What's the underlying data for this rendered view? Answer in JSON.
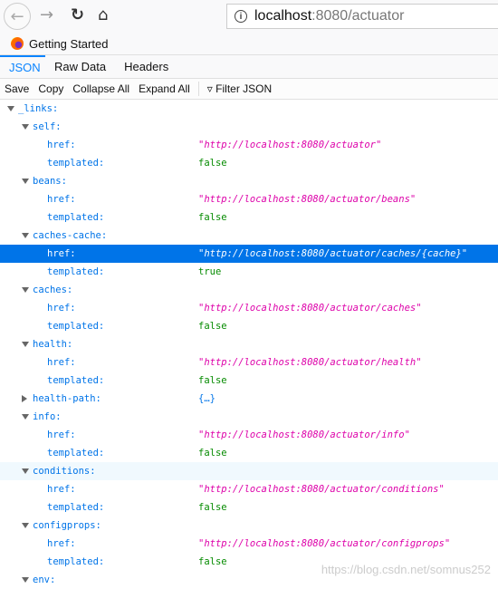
{
  "browser": {
    "url_host": "localhost",
    "url_rest": ":8080/actuator",
    "bookmark": "Getting Started"
  },
  "tabs": [
    "JSON",
    "Raw Data",
    "Headers"
  ],
  "toolbar": {
    "save": "Save",
    "copy": "Copy",
    "collapse": "Collapse All",
    "expand": "Expand All",
    "filter_placeholder": "Filter JSON"
  },
  "rows": [
    {
      "level": 0,
      "key": "_links:",
      "state": "open"
    },
    {
      "level": 1,
      "key": "self:",
      "state": "open"
    },
    {
      "level": 2,
      "key": "href:",
      "value": "\"http://localhost:8080/actuator\"",
      "type": "str"
    },
    {
      "level": 2,
      "key": "templated:",
      "value": "false",
      "type": "bool"
    },
    {
      "level": 1,
      "key": "beans:",
      "state": "open"
    },
    {
      "level": 2,
      "key": "href:",
      "value": "\"http://localhost:8080/actuator/beans\"",
      "type": "str"
    },
    {
      "level": 2,
      "key": "templated:",
      "value": "false",
      "type": "bool"
    },
    {
      "level": 1,
      "key": "caches-cache:",
      "state": "open"
    },
    {
      "level": 2,
      "key": "href:",
      "value": "\"http://localhost:8080/actuator/caches/{cache}\"",
      "type": "str",
      "selected": true
    },
    {
      "level": 2,
      "key": "templated:",
      "value": "true",
      "type": "bool"
    },
    {
      "level": 1,
      "key": "caches:",
      "state": "open"
    },
    {
      "level": 2,
      "key": "href:",
      "value": "\"http://localhost:8080/actuator/caches\"",
      "type": "str"
    },
    {
      "level": 2,
      "key": "templated:",
      "value": "false",
      "type": "bool"
    },
    {
      "level": 1,
      "key": "health:",
      "state": "open"
    },
    {
      "level": 2,
      "key": "href:",
      "value": "\"http://localhost:8080/actuator/health\"",
      "type": "str"
    },
    {
      "level": 2,
      "key": "templated:",
      "value": "false",
      "type": "bool"
    },
    {
      "level": 1,
      "key": "health-path:",
      "state": "closed",
      "value": "{…}",
      "type": "obj"
    },
    {
      "level": 1,
      "key": "info:",
      "state": "open"
    },
    {
      "level": 2,
      "key": "href:",
      "value": "\"http://localhost:8080/actuator/info\"",
      "type": "str"
    },
    {
      "level": 2,
      "key": "templated:",
      "value": "false",
      "type": "bool"
    },
    {
      "level": 1,
      "key": "conditions:",
      "state": "open",
      "hover": true
    },
    {
      "level": 2,
      "key": "href:",
      "value": "\"http://localhost:8080/actuator/conditions\"",
      "type": "str"
    },
    {
      "level": 2,
      "key": "templated:",
      "value": "false",
      "type": "bool"
    },
    {
      "level": 1,
      "key": "configprops:",
      "state": "open"
    },
    {
      "level": 2,
      "key": "href:",
      "value": "\"http://localhost:8080/actuator/configprops\"",
      "type": "str"
    },
    {
      "level": 2,
      "key": "templated:",
      "value": "false",
      "type": "bool"
    },
    {
      "level": 1,
      "key": "env:",
      "state": "open"
    }
  ],
  "watermark": "https://blog.csdn.net/somnus252"
}
